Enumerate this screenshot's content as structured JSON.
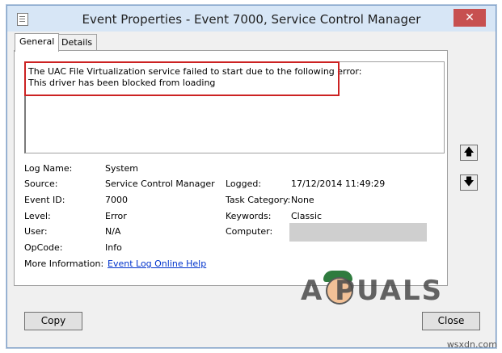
{
  "window": {
    "title": "Event Properties - Event 7000, Service Control Manager",
    "close_glyph": "✕"
  },
  "tabs": [
    {
      "label": "General",
      "active": true
    },
    {
      "label": "Details",
      "active": false
    }
  ],
  "description": {
    "line1": "The UAC File Virtualization service failed to start due to the following error:",
    "line2": "This driver has been blocked from loading",
    "highlight_color": "#cc2222"
  },
  "fields": {
    "log_name": {
      "label": "Log Name:",
      "value": "System"
    },
    "source": {
      "label": "Source:",
      "value": "Service Control Manager"
    },
    "event_id": {
      "label": "Event ID:",
      "value": "7000"
    },
    "level": {
      "label": "Level:",
      "value": "Error"
    },
    "user": {
      "label": "User:",
      "value": "N/A"
    },
    "opcode": {
      "label": "OpCode:",
      "value": "Info"
    },
    "more_info": {
      "label": "More Information:",
      "link": "Event Log Online Help"
    },
    "logged": {
      "label": "Logged:",
      "value": "17/12/2014 11:49:29"
    },
    "task_category": {
      "label": "Task Category:",
      "value": "None"
    },
    "keywords": {
      "label": "Keywords:",
      "value": "Classic"
    },
    "computer": {
      "label": "Computer:",
      "value": ""
    }
  },
  "side_buttons": {
    "up_glyph": "🡅",
    "down_glyph": "🡇"
  },
  "buttons": {
    "copy": "Copy",
    "close": "Close"
  },
  "watermark": {
    "text": "A  PUALS",
    "credit": "wsxdn.com"
  }
}
